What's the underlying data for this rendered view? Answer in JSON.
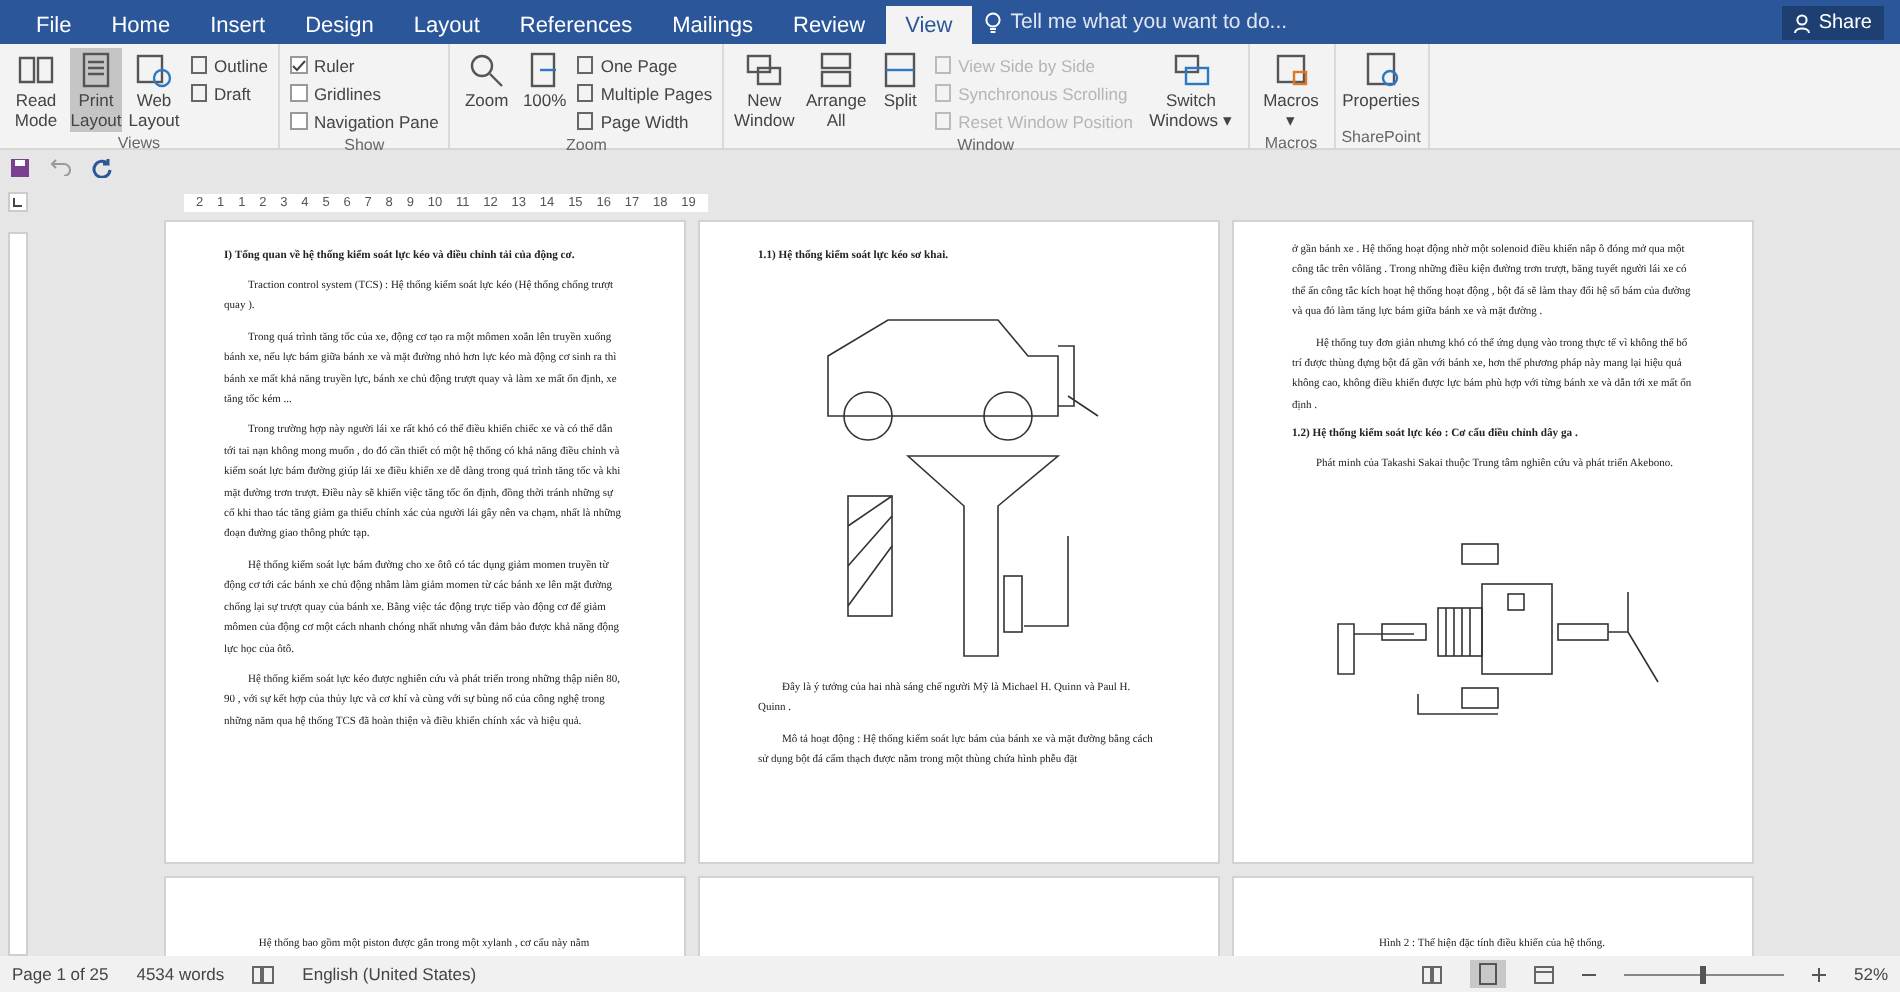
{
  "ribbon": {
    "tabs": [
      {
        "label": "File",
        "selected": false
      },
      {
        "label": "Home",
        "selected": false
      },
      {
        "label": "Insert",
        "selected": false
      },
      {
        "label": "Design",
        "selected": false
      },
      {
        "label": "Layout",
        "selected": false
      },
      {
        "label": "References",
        "selected": false
      },
      {
        "label": "Mailings",
        "selected": false
      },
      {
        "label": "Review",
        "selected": false
      },
      {
        "label": "View",
        "selected": true
      }
    ],
    "tell_me": {
      "placeholder": "Tell me what you want to do..."
    },
    "share": "Share",
    "groups": [
      {
        "label": "Views",
        "items": [
          {
            "kind": "large",
            "label": "Read Mode",
            "selected": false
          },
          {
            "kind": "large",
            "label": "Print Layout",
            "selected": true
          },
          {
            "kind": "large",
            "label": "Web Layout",
            "selected": false
          },
          {
            "kind": "stack",
            "items": [
              {
                "label": "Outline",
                "disabled": false
              },
              {
                "label": "Draft",
                "disabled": false
              }
            ]
          }
        ]
      },
      {
        "label": "Show",
        "items": [
          {
            "kind": "checks",
            "items": [
              {
                "label": "Ruler",
                "checked": true
              },
              {
                "label": "Gridlines",
                "checked": false
              },
              {
                "label": "Navigation Pane",
                "checked": false
              }
            ]
          }
        ]
      },
      {
        "label": "Zoom",
        "items": [
          {
            "kind": "large",
            "label": "Zoom",
            "selected": false
          },
          {
            "kind": "large",
            "label": "100%",
            "selected": false
          },
          {
            "kind": "stack",
            "items": [
              {
                "label": "One Page",
                "disabled": false
              },
              {
                "label": "Multiple Pages",
                "disabled": false
              },
              {
                "label": "Page Width",
                "disabled": false
              }
            ]
          }
        ]
      },
      {
        "label": "Window",
        "items": [
          {
            "kind": "large",
            "label": "New Window",
            "selected": false
          },
          {
            "kind": "large",
            "label": "Arrange All",
            "selected": false
          },
          {
            "kind": "large",
            "label": "Split",
            "selected": false
          },
          {
            "kind": "stack",
            "items": [
              {
                "label": "View Side by Side",
                "disabled": true
              },
              {
                "label": "Synchronous Scrolling",
                "disabled": true
              },
              {
                "label": "Reset Window Position",
                "disabled": true
              }
            ]
          },
          {
            "kind": "large",
            "label": "Switch Windows ▾",
            "selected": false
          }
        ]
      },
      {
        "label": "Macros",
        "items": [
          {
            "kind": "large",
            "label": "Macros ▾",
            "selected": false
          }
        ]
      },
      {
        "label": "SharePoint",
        "items": [
          {
            "kind": "large",
            "label": "Properties",
            "selected": false
          }
        ]
      }
    ]
  },
  "ruler": {
    "marks": [
      "2",
      "1",
      "1",
      "2",
      "3",
      "4",
      "5",
      "6",
      "7",
      "8",
      "9",
      "10",
      "11",
      "12",
      "13",
      "14",
      "15",
      "16",
      "17",
      "18",
      "19"
    ]
  },
  "pages": [
    {
      "left": {
        "blocks": [
          {
            "kind": "heading",
            "text": "I) Tổng quan về hệ thống kiểm soát lực kéo và điều chỉnh tải của động cơ."
          },
          {
            "kind": "para",
            "text": "Traction control system (TCS) : Hệ thống kiểm soát lực kéo (Hệ thống chống trượt quay )."
          },
          {
            "kind": "para",
            "text": "Trong quá trình tăng tốc của xe, động cơ tạo ra một mômen xoắn lên truyền xuống bánh xe, nếu lực bám giữa bánh xe và mặt đường nhỏ hơn lực kéo mà động cơ sinh ra thì bánh xe mất khả năng truyền lực, bánh xe chủ động trượt quay và làm xe mất ổn định, xe tăng tốc kém ..."
          },
          {
            "kind": "para",
            "text": "Trong trường hợp này người lái xe rất khó có thể điều khiển chiếc xe và có thể dẫn tới tai nạn không mong muốn , do đó cần thiết có một hệ thống có khả năng điều chỉnh và kiểm soát lực bám đường giúp lái xe điều khiển xe dễ dàng trong quá trình tăng tốc và khi mặt đường trơn trượt. Điều này sẽ khiến việc tăng tốc ổn định, đồng thời tránh những sự cố khi thao tác tăng giảm ga thiếu chính xác của người lái gây nên va chạm, nhất là những đoạn đường giao thông phức tạp."
          },
          {
            "kind": "para",
            "text": "Hệ thống kiểm soát lực bám đường cho xe ôtô có tác dụng giảm momen truyền từ động cơ tới các bánh xe chủ động nhằm làm giảm momen từ các bánh xe lên mặt đường chống lại sự trượt quay của bánh xe. Bằng việc tác động trực tiếp vào động cơ để giảm mômen của động cơ một cách nhanh chóng nhất nhưng vẫn đảm bảo được khả năng động lực học của ôtô."
          },
          {
            "kind": "para",
            "text": "Hệ thống kiểm soát lực kéo được nghiên cứu và phát triển trong những thập niên 80, 90 , với sự kết hợp của thủy lực và cơ khí và cùng với sự bùng nổ của công nghệ trong những năm qua hệ thống TCS đã hoàn thiện và điều khiển chính xác và hiệu quả."
          }
        ]
      },
      "middle": {
        "blocks": [
          {
            "kind": "heading",
            "text": "1.1)  Hệ thống kiểm soát lực kéo sơ khai."
          },
          {
            "kind": "figure"
          },
          {
            "kind": "para",
            "text": "Đây là ý tưởng của hai nhà sáng chế người Mỹ là Michael H. Quinn  và Paul H. Quinn ."
          },
          {
            "kind": "para",
            "text": "Mô tả hoạt động : Hệ thống kiểm soát lực bám của bánh xe và mặt đường bằng cách sử dụng bột đá cẩm thạch được nằm trong một thùng chứa hình phễu đặt"
          }
        ]
      },
      "right": {
        "blocks": [
          {
            "kind": "flush",
            "text": "ở gần bánh xe . Hệ thống hoạt động nhờ một solenoid điều khiển nắp ô đóng mở qua một công tắc trên vôlăng . Trong những điều kiện đường trơn trượt, băng tuyết người lái xe có thể ấn công tắc kích hoạt hệ thống hoạt động , bột đá sẽ làm thay đổi hệ số bám của đường và qua đó làm tăng lực bám giữa bánh xe và mặt đường ."
          },
          {
            "kind": "para",
            "text": "Hệ thống tuy đơn giản nhưng khó có thể ứng dụng vào trong thực tế vì không thể bố trí được thùng đựng bột đá gần với bánh xe, hơn thế phương pháp này mang lại hiệu quả không cao, không điều khiển được lực bám phù hợp với từng bánh xe và dẫn tới xe mất ổn định ."
          },
          {
            "kind": "heading",
            "text": "1.2) Hệ thống kiểm soát lực kéo : Cơ cấu điều chỉnh dây ga ."
          },
          {
            "kind": "para",
            "text": "Phát minh của Takashi Sakai thuộc Trung tâm nghiên cứu và phát triển Akebono."
          },
          {
            "kind": "figure"
          }
        ]
      }
    },
    {
      "left": {
        "blocks": [
          {
            "kind": "center",
            "text": "Hệ thống bao gồm một piston được gắn trong một xylanh , cơ cấu này nằm"
          }
        ]
      },
      "right": {
        "blocks": [
          {
            "kind": "center",
            "text": "Hình 2 : Thể hiện đặc tính điều khiển của hệ thống."
          }
        ]
      }
    }
  ],
  "status_bar": {
    "page": "Page 1 of 25",
    "words": "4534 words",
    "language": "English (United States)",
    "zoom": "52%",
    "zoom_slider": {
      "level": 0.5
    }
  }
}
